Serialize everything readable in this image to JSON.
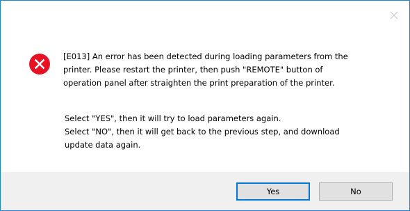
{
  "dialog": {
    "message_main": "[E013] An error has been detected during loading parameters from the\nprinter. Please restart the printer, then push \"REMOTE\" button of\noperation panel after straighten the print preparation of the printer.",
    "message_sub": "Select \"YES\", then it will try to load parameters again.\nSelect \"NO\", then it will get back to the previous step, and download\nupdate data again.",
    "icon": "error-icon",
    "close_icon": "close-icon"
  },
  "buttons": {
    "yes_label": "Yes",
    "no_label": "No"
  },
  "colors": {
    "border": "#1883d7",
    "error_red": "#e81123",
    "footer_bg": "#f0f0f0",
    "focus_border": "#0078d7"
  }
}
